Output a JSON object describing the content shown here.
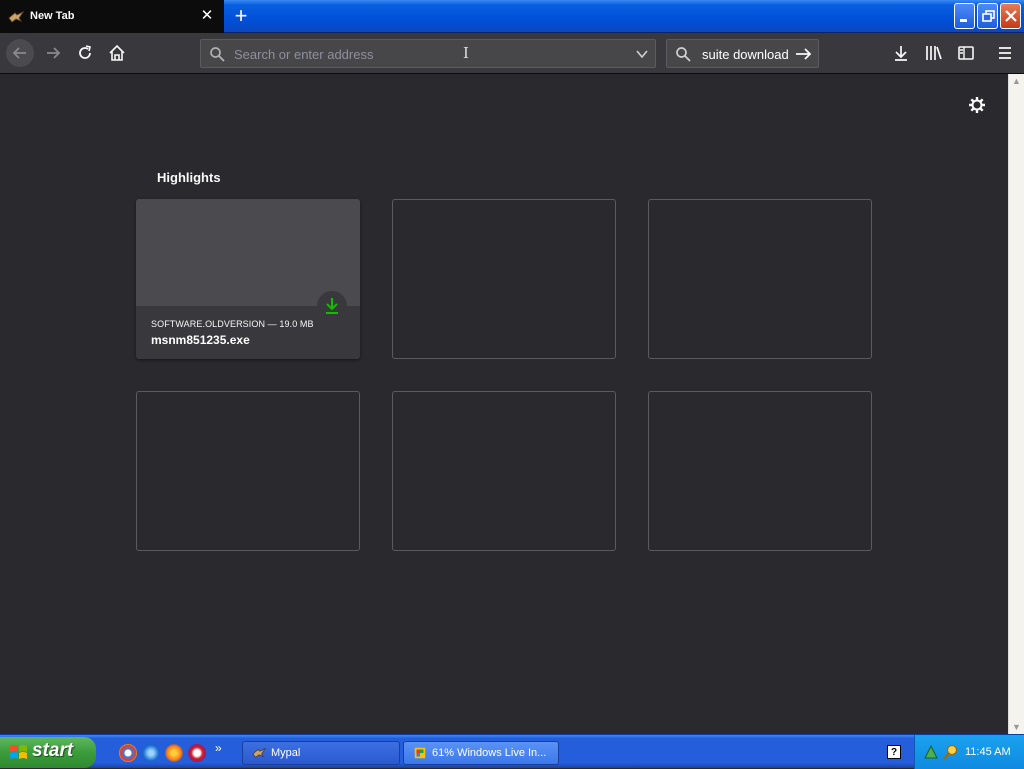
{
  "tab": {
    "title": "New Tab",
    "close": "✕"
  },
  "toolbar": {
    "url_placeholder": "Search or enter address",
    "search_text": "suite download"
  },
  "content": {
    "highlights_title": "Highlights",
    "cards": [
      {
        "meta": "SOFTWARE.OLDVERSION — 19.0 MB",
        "filename": "msnm851235.exe"
      }
    ]
  },
  "taskbar": {
    "start_label": "start",
    "items": [
      {
        "label": "Mypal"
      },
      {
        "label": "61% Windows Live In..."
      }
    ],
    "clock": "11:45 AM",
    "help": "?",
    "overflow": "»"
  },
  "colors": {
    "accent_green": "#12bc00",
    "xp_blue": "#245edb",
    "background": "#2a2a2e"
  }
}
